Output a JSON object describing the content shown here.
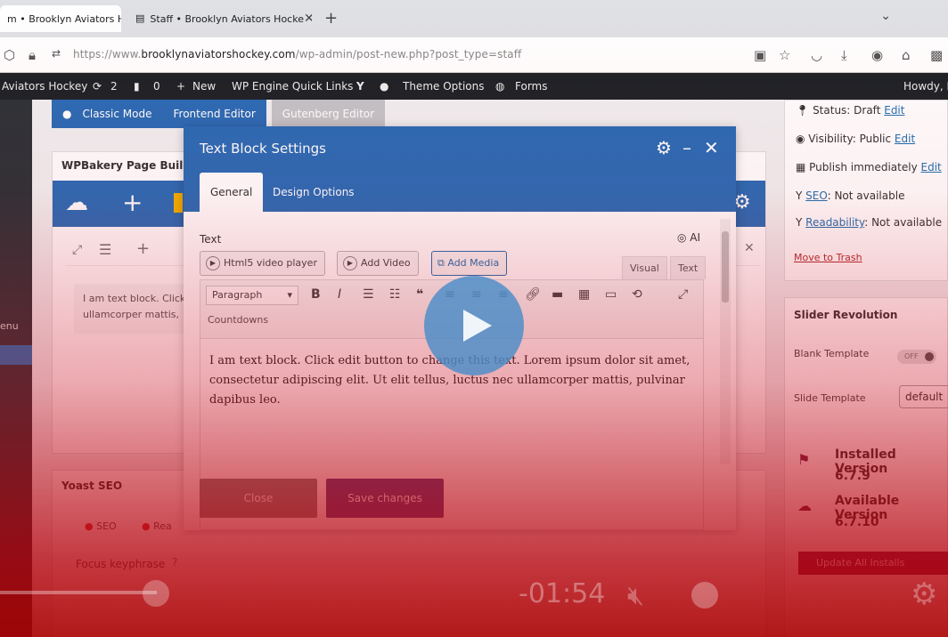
{
  "browser": {
    "tabs": [
      {
        "label": "m • Brooklyn Aviators H"
      },
      {
        "label": "Staff • Brooklyn Aviators Hocke"
      }
    ],
    "new_tab": "+",
    "url_prefix": "https://www.",
    "url_host": "brooklynaviatorshockey.com",
    "url_path": "/wp-admin/post-new.php?post_type=staff"
  },
  "adminbar": {
    "site_name": "Aviators Hockey",
    "updates_count": "2",
    "comments_count": "0",
    "new_label": "New",
    "wp_engine": "WP Engine Quick Links",
    "theme_options": "Theme Options",
    "forms": "Forms",
    "howdy": "Howdy, I"
  },
  "sidebar": {
    "menu_label": "enu"
  },
  "editor": {
    "classic_mode": "Classic Mode",
    "frontend_editor": "Frontend Editor",
    "gutenberg_editor": "Gutenberg Editor",
    "wpb_title": "WPBakery Page Builder",
    "wpb_text": "I am text block. Click ullamcorper mattis,",
    "yoast_title": "Yoast SEO",
    "yoast_tab_seo": "SEO",
    "yoast_tab_read": "Rea",
    "focus_keyphrase": "Focus keyphrase"
  },
  "publish": {
    "status": "Status: Draft",
    "status_edit": "Edit",
    "visibility": "Visibility: Public",
    "visibility_edit": "Edit",
    "publish_when": "Publish immediately",
    "publish_edit": "Edit",
    "seo_label": "SEO",
    "seo_value": ": Not available",
    "readability_label": "Readability",
    "readability_value": ": Not available",
    "trash": "Move to Trash"
  },
  "slider": {
    "title": "Slider Revolution",
    "blank_template": "Blank Template",
    "toggle": "OFF",
    "slide_template": "Slide Template",
    "slide_template_value": "default",
    "installed_label": "Installed Version",
    "installed_value": "6.7.9",
    "available_label": "Available Version",
    "available_value": "6.7.10",
    "update_btn": "Update All Installs"
  },
  "modal": {
    "title": "Text Block Settings",
    "tab_general": "General",
    "tab_design": "Design Options",
    "text_label": "Text",
    "ai_label": "AI",
    "btn_html5": "Html5 video player",
    "btn_add_video": "Add Video",
    "btn_add_media": "Add Media",
    "tab_visual": "Visual",
    "tab_text": "Text",
    "paragraph": "Paragraph",
    "countdowns": "Countdowns",
    "content": "I am text block. Click edit button to change this text. Lorem ipsum dolor sit amet, consectetur adipiscing elit. Ut elit tellus, luctus nec ullamcorper mattis, pulvinar dapibus leo.",
    "btn_close": "Close",
    "btn_save": "Save changes"
  },
  "video": {
    "time": "-01:54"
  }
}
